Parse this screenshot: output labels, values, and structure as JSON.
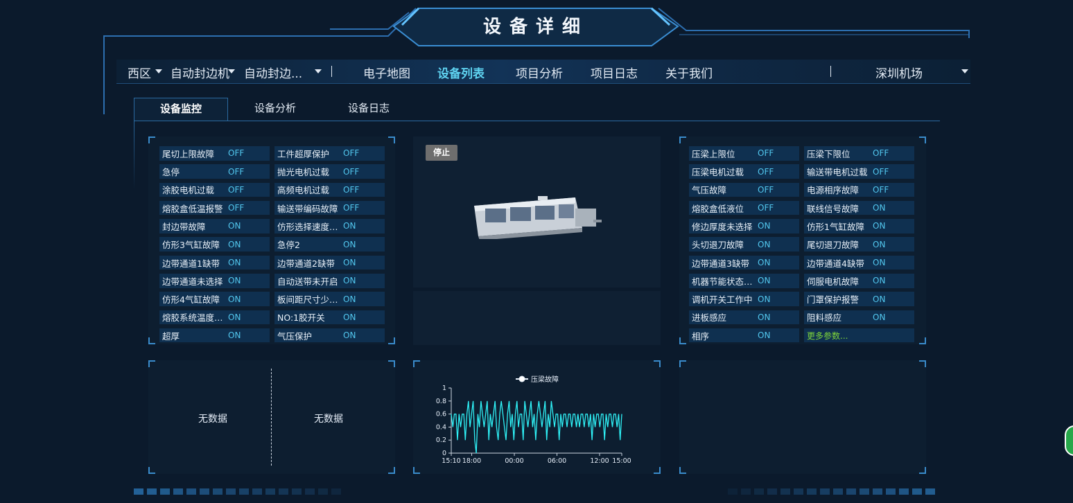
{
  "header": {
    "title": "设备详细"
  },
  "nav": {
    "region": "西区",
    "device_type": "自动封边机",
    "device_name": "自动封边...",
    "links": [
      "电子地图",
      "设备列表",
      "项目分析",
      "项目日志",
      "关于我们"
    ],
    "active_link": "设备列表",
    "site": "深圳机场"
  },
  "tabs": [
    {
      "label": "设备监控",
      "active": true
    },
    {
      "label": "设备分析",
      "active": false
    },
    {
      "label": "设备日志",
      "active": false
    }
  ],
  "left_status": [
    {
      "label": "尾切上限故障",
      "value": "OFF"
    },
    {
      "label": "工件超厚保护",
      "value": "OFF"
    },
    {
      "label": "急停",
      "value": "OFF"
    },
    {
      "label": "抛光电机过载",
      "value": "OFF"
    },
    {
      "label": "涂胶电机过载",
      "value": "OFF"
    },
    {
      "label": "高频电机过载",
      "value": "OFF"
    },
    {
      "label": "熔胶盒低温报警",
      "value": "OFF"
    },
    {
      "label": "输送带编码故障",
      "value": "OFF"
    },
    {
      "label": "封边带故障",
      "value": "ON"
    },
    {
      "label": "仿形选择速度过...",
      "value": "ON"
    },
    {
      "label": "仿形3气缸故障",
      "value": "ON"
    },
    {
      "label": "急停2",
      "value": "ON"
    },
    {
      "label": "边带通道1缺带",
      "value": "ON"
    },
    {
      "label": "边带通道2缺带",
      "value": "ON"
    },
    {
      "label": "边带通道未选择",
      "value": "ON"
    },
    {
      "label": "自动送带未开启",
      "value": "ON"
    },
    {
      "label": "仿形4气缸故障",
      "value": "ON"
    },
    {
      "label": "板间距尺寸少于...",
      "value": "ON"
    },
    {
      "label": "熔胶系统温度异...",
      "value": "ON"
    },
    {
      "label": "NO:1胶开关",
      "value": "ON"
    },
    {
      "label": "超厚",
      "value": "ON"
    },
    {
      "label": "气压保护",
      "value": "ON"
    }
  ],
  "right_status": [
    {
      "label": "压梁上限位",
      "value": "OFF"
    },
    {
      "label": "压梁下限位",
      "value": "OFF"
    },
    {
      "label": "压梁电机过载",
      "value": "OFF"
    },
    {
      "label": "输送带电机过载",
      "value": "OFF"
    },
    {
      "label": "气压故障",
      "value": "OFF"
    },
    {
      "label": "电源相序故障",
      "value": "OFF"
    },
    {
      "label": "熔胶盒低液位",
      "value": "OFF"
    },
    {
      "label": "联线信号故障",
      "value": "ON"
    },
    {
      "label": "修边厚度未选择",
      "value": "ON"
    },
    {
      "label": "仿形1气缸故障",
      "value": "ON"
    },
    {
      "label": "头切退刀故障",
      "value": "ON"
    },
    {
      "label": "尾切退刀故障",
      "value": "ON"
    },
    {
      "label": "边带通道3缺带",
      "value": "ON"
    },
    {
      "label": "边带通道4缺带",
      "value": "ON"
    },
    {
      "label": "机器节能状态中...",
      "value": "ON"
    },
    {
      "label": "伺服电机故障",
      "value": "ON"
    },
    {
      "label": "调机开关工作中",
      "value": "ON"
    },
    {
      "label": "门罩保护报警",
      "value": "ON"
    },
    {
      "label": "进板感应",
      "value": "ON"
    },
    {
      "label": "阻料感应",
      "value": "ON"
    },
    {
      "label": "相序",
      "value": "ON"
    }
  ],
  "more_params": "更多参数...",
  "device_status": "停止",
  "no_data": [
    "无数据",
    "无数据"
  ],
  "colors": {
    "accent": "#5fd3f1",
    "on_off": "#52c7ee",
    "more": "#7fd63a",
    "series": "#2ff2f7",
    "badge": "#6e6e6e"
  },
  "chart_data": {
    "type": "line",
    "title": "",
    "series": [
      {
        "name": "压梁故障"
      }
    ],
    "x_tick_labels": [
      "15:10",
      "18:00",
      "00:00",
      "06:00",
      "12:00",
      "15:00"
    ],
    "y_tick_labels": [
      "0",
      "0.2",
      "0.4",
      "0.6",
      "0.8",
      "1"
    ],
    "ylim": [
      0,
      1
    ],
    "values": [
      0.6,
      0.4,
      0.6,
      0.6,
      0.2,
      0.6,
      0.4,
      0.6,
      0.6,
      0.2,
      0.6,
      0.8,
      0.4,
      0.6,
      0.8,
      0.2,
      0,
      0.6,
      0.4,
      0.8,
      0.6,
      0.4,
      0.6,
      0.8,
      0.2,
      0.6,
      0.4,
      0.6,
      0.8,
      0.4,
      0.2,
      0.6,
      0.8,
      0.6,
      0.4,
      0.2,
      0.6,
      0.8,
      0.4,
      0.6,
      0.2,
      0.6,
      0.8,
      0.4,
      0.6,
      0.6,
      0.2,
      0.8,
      0.6,
      0.4,
      0.6,
      0.8,
      0.4,
      0.6,
      0.2,
      0.6,
      0.8,
      0.6,
      0.4,
      0.6,
      0.8,
      0.2,
      0.6,
      0.4,
      0.8,
      0.6,
      0.4,
      0.6,
      0.6,
      0.2,
      0.6,
      0.4,
      0.6,
      0.6,
      0.4,
      0.6,
      0.6,
      0.4,
      0.6,
      0.6,
      0.4,
      0.6,
      0.4,
      0.6,
      0.6,
      0.4,
      0.6,
      0.6,
      0.4,
      0.6,
      0.2,
      0.6,
      0.4,
      0.6,
      0.6,
      0.4,
      0.6,
      0.6,
      0.2,
      0.6,
      0.4,
      0.6,
      0.6,
      0.4,
      0.6,
      0.6,
      0.4,
      0.6,
      0.2,
      0.6
    ]
  }
}
